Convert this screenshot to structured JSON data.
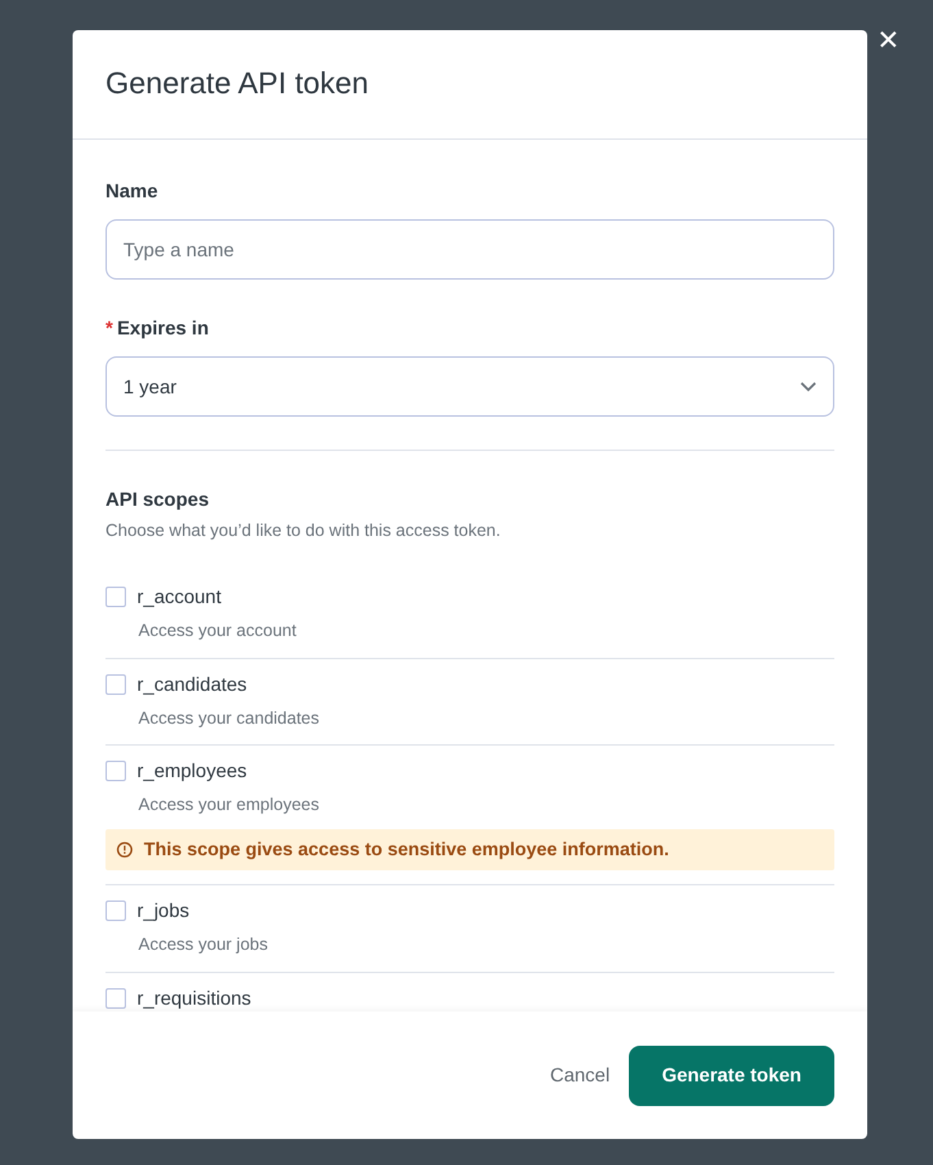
{
  "dialog": {
    "title": "Generate API token",
    "close_icon": "✕",
    "name_field": {
      "label": "Name",
      "placeholder": "Type a name"
    },
    "expires_field": {
      "required_mark": "*",
      "label": "Expires in",
      "value": "1 year"
    },
    "scopes": {
      "title": "API scopes",
      "description": "Choose what you’d like to do with this access token.",
      "items": [
        {
          "name": "r_account",
          "description": "Access your account",
          "checked": false
        },
        {
          "name": "r_candidates",
          "description": "Access your candidates",
          "checked": false
        },
        {
          "name": "r_employees",
          "description": "Access your employees",
          "checked": false,
          "warning": "This scope gives access to sensitive employee information."
        },
        {
          "name": "r_jobs",
          "description": "Access your jobs",
          "checked": false
        },
        {
          "name": "r_requisitions",
          "checked": false
        }
      ]
    },
    "buttons": [
      {
        "label": "Cancel",
        "kind": "link"
      },
      {
        "label": "Generate token",
        "kind": "primary"
      }
    ]
  }
}
